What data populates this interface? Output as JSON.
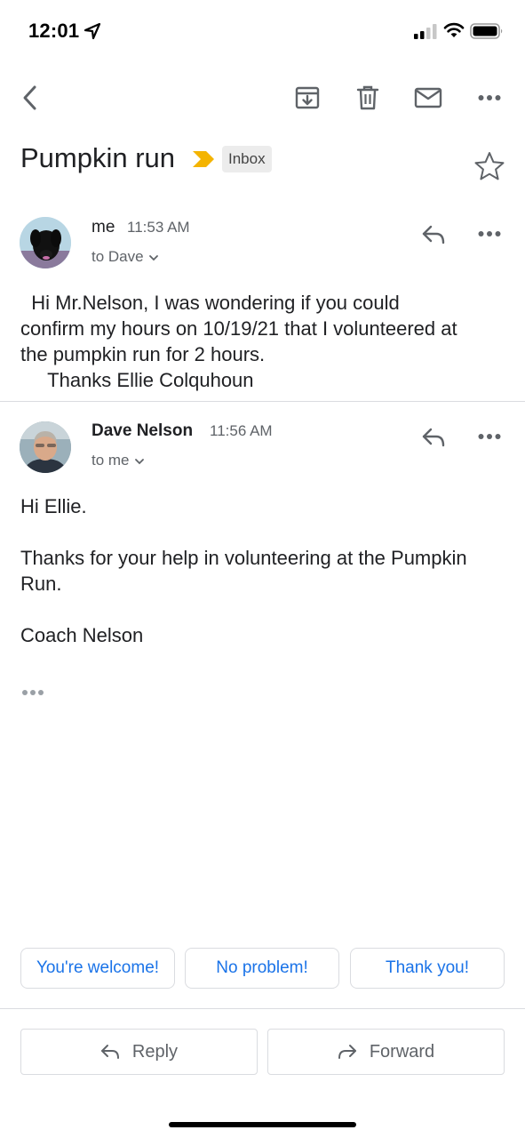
{
  "status_bar": {
    "time": "12:01"
  },
  "toolbar": {
    "icons": [
      "back-icon",
      "archive-icon",
      "delete-icon",
      "mark-unread-icon",
      "more-icon"
    ]
  },
  "subject": {
    "title": "Pumpkin run",
    "label": "Inbox",
    "importance_color": "#f4b400"
  },
  "messages": [
    {
      "sender": "me",
      "time": "11:53 AM",
      "recipient": "to Dave",
      "body": [
        "  Hi Mr.Nelson, I was wondering if you could",
        "confirm my hours on 10/19/21 that I volunteered at",
        "the pumpkin run for 2 hours.",
        "     Thanks Ellie Colquhoun"
      ]
    },
    {
      "sender": "Dave Nelson",
      "time": "11:56 AM",
      "recipient": "to me",
      "body": [
        "Hi Ellie.",
        "",
        "Thanks for your help in volunteering at the Pumpkin",
        "Run.",
        "",
        "Coach Nelson"
      ]
    }
  ],
  "smart_replies": [
    "You're welcome!",
    "No problem!",
    "Thank you!"
  ],
  "actions": {
    "reply": "Reply",
    "forward": "Forward"
  },
  "colors": {
    "accent": "#1a73e8",
    "text": "#202124",
    "secondary_text": "#5f6368",
    "border": "#dadce0"
  }
}
